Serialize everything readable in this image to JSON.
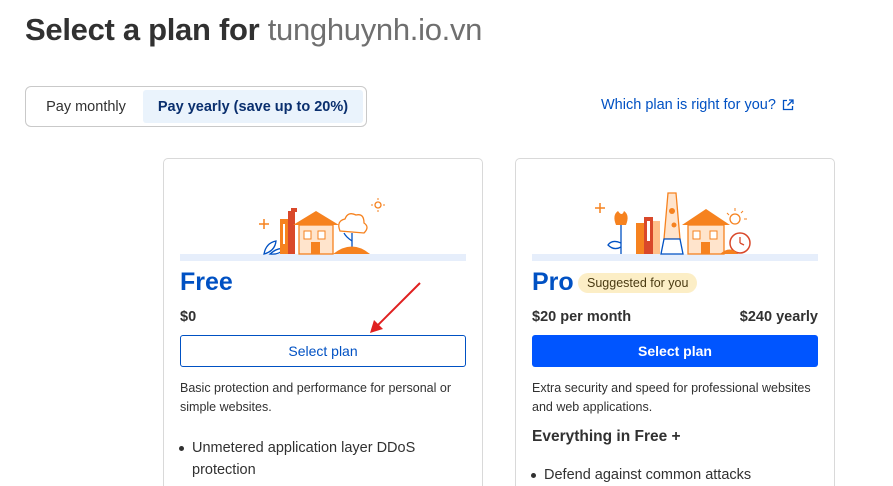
{
  "header": {
    "title_prefix": "Select a plan for",
    "domain": "tunghuynh.io.vn"
  },
  "billing_toggle": {
    "monthly_label": "Pay monthly",
    "yearly_label": "Pay yearly (save up to 20%)",
    "selected": "yearly"
  },
  "help_link": {
    "label": "Which plan is right for you?",
    "icon": "external-link-icon"
  },
  "plans": [
    {
      "name": "Free",
      "price": "$0",
      "button_label": "Select plan",
      "description": "Basic protection and performance for personal or simple websites.",
      "features": [
        "Unmetered application layer DDoS protection"
      ]
    },
    {
      "name": "Pro",
      "badge": "Suggested for you",
      "price_monthly": "$20 per month",
      "price_yearly": "$240 yearly",
      "button_label": "Select plan",
      "description": "Extra security and speed for professional websites and web applications.",
      "section_heading": "Everything in Free +",
      "features": [
        "Defend against common attacks"
      ]
    }
  ],
  "colors": {
    "accent": "#0051c3",
    "primary_button": "#0055ff",
    "illustration_orange": "#f6821f",
    "badge_bg": "#fceec6",
    "annotation_arrow": "#e02020"
  }
}
